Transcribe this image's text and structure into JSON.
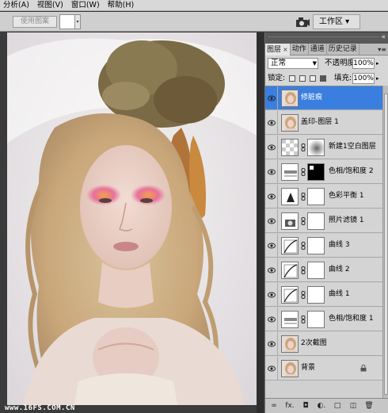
{
  "menubar": {
    "items": [
      "分析(A)",
      "视图(V)",
      "窗口(W)",
      "帮助(H)"
    ]
  },
  "optionsbar": {
    "use_pattern_label": "使用图案",
    "workspace_label": "工作区 ▾"
  },
  "watermark": "www.16FS.COM.CN",
  "panel": {
    "tabs": [
      {
        "label": "图层",
        "close": "×",
        "active": true
      },
      {
        "label": "动作",
        "active": false
      },
      {
        "label": "通道",
        "active": false
      },
      {
        "label": "历史记录",
        "active": false
      }
    ],
    "tab_menu": "▾≡",
    "blend_mode": "正常",
    "opacity_label": "不透明度:",
    "opacity_value": "100%",
    "lock_label": "锁定:",
    "fill_label": "填充:",
    "fill_value": "100%",
    "layers": [
      {
        "name": "修脏痕",
        "type": "photo",
        "selected": true
      },
      {
        "name": "盖印-图层 1",
        "type": "photo",
        "selected": false
      },
      {
        "name": "新建1空白图层",
        "type": "empty-mask",
        "selected": false
      },
      {
        "name": "色相/饱和度 2",
        "type": "huesat-blackmask",
        "selected": false
      },
      {
        "name": "色彩平衡 1",
        "type": "colorbalance",
        "selected": false
      },
      {
        "name": "照片滤镜 1",
        "type": "photofilter",
        "selected": false
      },
      {
        "name": "曲线 3",
        "type": "curves",
        "selected": false
      },
      {
        "name": "曲线 2",
        "type": "curves",
        "selected": false
      },
      {
        "name": "曲线 1",
        "type": "curves",
        "selected": false
      },
      {
        "name": "色相/饱和度 1",
        "type": "huesat",
        "selected": false
      },
      {
        "name": "2次截图",
        "type": "photo",
        "selected": false
      },
      {
        "name": "背景",
        "type": "photo-locked",
        "selected": false
      }
    ],
    "bottom_icons": [
      "link-icon",
      "fx-icon",
      "mask-icon",
      "adjustment-icon",
      "group-icon",
      "new-layer-icon",
      "trash-icon"
    ],
    "bottom_labels": [
      "∞",
      "fx.",
      "◘",
      "◐.",
      "□",
      "◫",
      "🗑"
    ]
  },
  "colors": {
    "selected_row": "#3a7fe0",
    "panel_bg": "#d6d6d6"
  }
}
